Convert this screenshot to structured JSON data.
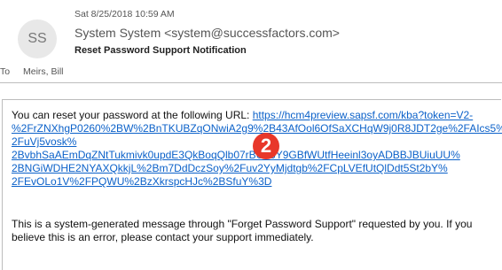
{
  "message": {
    "avatar_initials": "SS",
    "date": "Sat 8/25/2018 10:59 AM",
    "from": "System System <system@successfactors.com>",
    "subject": "Reset Password Support Notification",
    "to_label": "To",
    "to_value": "Meirs, Bill"
  },
  "body": {
    "intro": "You can reset your password at the following URL:",
    "link_lines": [
      "https://hcm4preview.sapsf.com/kba?token=V2-",
      "%2FrZNXhgP0260%2BW%2BnTKUBZqONwiA2g9%2B43AfOol6OfSaXCHqW9j0R8JDT2ge%2FAIcs5%",
      "2FuVj5vosk%",
      "2BvbhSaAEmDqZNtTukmivk0updE3QkBoqQlb07rBU13Y9GBfWUtfHeeinl3oyADBBJBUiuUU%",
      "2BNGiWDHE2NYAXQkkjL%2Bm7DdDczSoy%2Fuv2YyMjdtgb%2FCpLVEfUtQlDdt5St2bY%",
      "2FEvOLo1V%2FPQWU%2BzXkrspcHJc%2BSfuY%3D"
    ],
    "notice": "This is a system-generated message through \"Forget Password Support\" requested by you.  If you believe this is an error, please contact your support immediately."
  },
  "annotation": {
    "step_number": "2",
    "color": "#e8372a"
  },
  "colors": {
    "link": "#0b61c9"
  }
}
